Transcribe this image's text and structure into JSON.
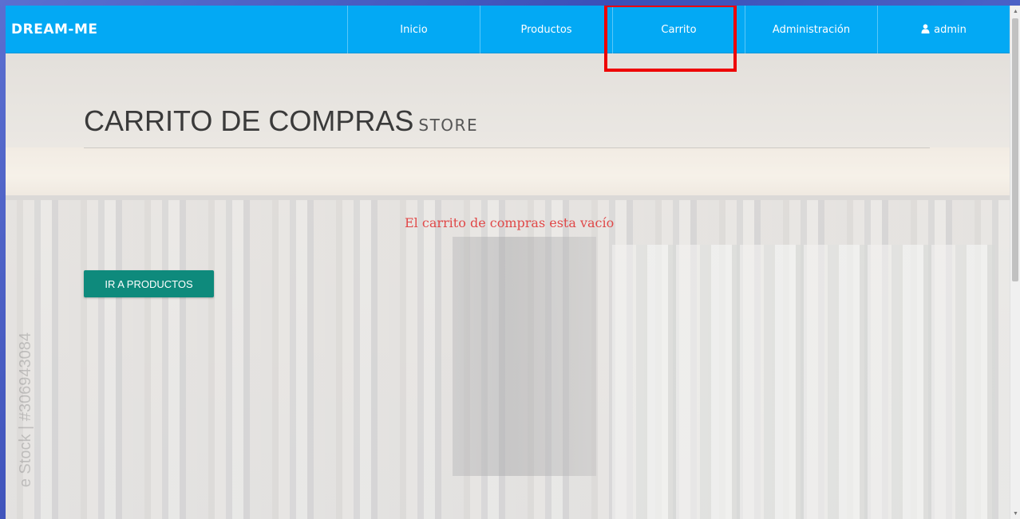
{
  "brand": "DREAM-ME",
  "nav": {
    "items": [
      {
        "label": "Inicio"
      },
      {
        "label": "Productos"
      },
      {
        "label": "Carrito"
      },
      {
        "label": "Administración"
      },
      {
        "label": "admin",
        "icon": "user-icon"
      }
    ]
  },
  "page": {
    "title": "CARRITO DE COMPRAS",
    "subtitle": "STORE",
    "empty_message": "El carrito de compras esta vacío",
    "button_label": "IR A PRODUCTOS"
  },
  "watermark": "e Stock | #306943084",
  "colors": {
    "navbar": "#03a9f4",
    "button": "#0e8a7c",
    "empty_message": "#e04848",
    "highlight": "#ee0000"
  }
}
